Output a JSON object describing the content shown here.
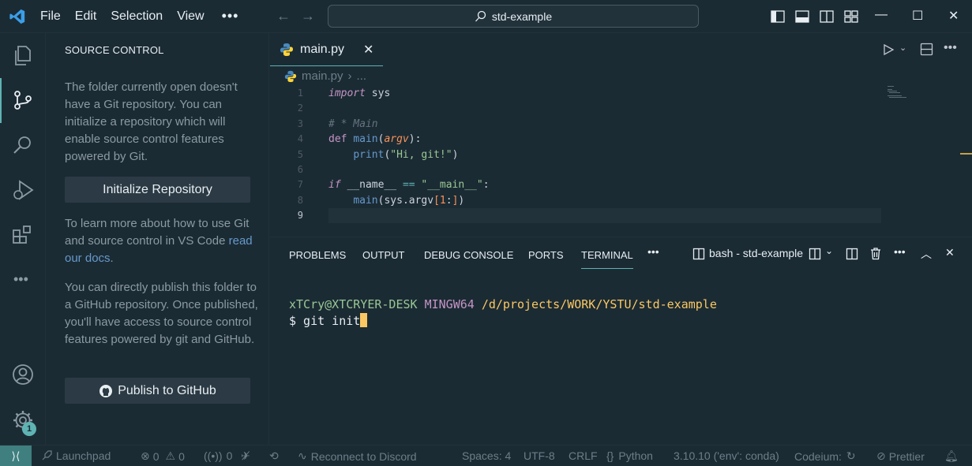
{
  "titlebar": {
    "menus": [
      "File",
      "Edit",
      "Selection",
      "View"
    ],
    "search_text": "std-example"
  },
  "sidebar": {
    "title": "SOURCE CONTROL",
    "intro_text": "The folder currently open doesn't have a Git repository. You can initialize a repository which will enable source control features powered by Git.",
    "init_button": "Initialize Repository",
    "learn_text": "To learn more about how to use Git and source control in VS Code ",
    "learn_link": "read our docs",
    "learn_end": ".",
    "publish_text": "You can directly publish this folder to a GitHub repository. Once published, you'll have access to source control features powered by git and GitHub.",
    "publish_button": "Publish to GitHub"
  },
  "activity": {
    "accounts_badge": "1"
  },
  "editor": {
    "tab_label": "main.py",
    "breadcrumb_file": "main.py",
    "breadcrumb_more": "...",
    "line_numbers": [
      "1",
      "2",
      "3",
      "4",
      "5",
      "6",
      "7",
      "8",
      "9"
    ]
  },
  "panel": {
    "tabs": [
      "PROBLEMS",
      "OUTPUT",
      "DEBUG CONSOLE",
      "PORTS",
      "TERMINAL"
    ],
    "active_tab": "TERMINAL",
    "terminal_name": "bash - std-example",
    "prompt_user": "xTCry@XTCRYER-DESK",
    "prompt_sys": "MINGW64",
    "prompt_path": "/d/projects/WORK/YSTU/std-example",
    "command": "$ git init"
  },
  "statusbar": {
    "launchpad": "Launchpad",
    "errors": "0",
    "warnings": "0",
    "ports": "0",
    "discord": "Reconnect to Discord",
    "spaces": "Spaces: 4",
    "encoding": "UTF-8",
    "eol": "CRLF",
    "language": "Python",
    "interpreter": "3.10.10 ('env': conda)",
    "codeium": "Codeium:",
    "prettier": "Prettier"
  },
  "colors": {
    "background": "#1b2b34",
    "accent": "#5fb3b3",
    "keyword": "#c594c5",
    "string": "#99c794",
    "path": "#fac863"
  }
}
